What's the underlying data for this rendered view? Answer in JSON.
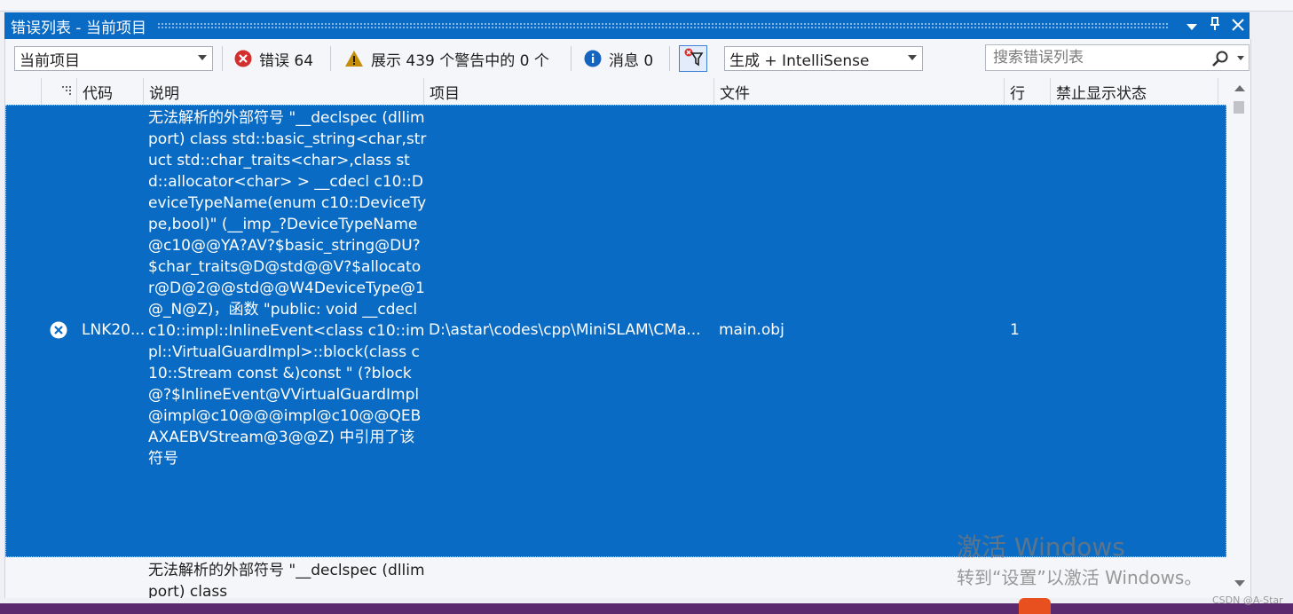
{
  "title_bar": {
    "title": "错误列表 - 当前项目",
    "dropdown_icon": "▼",
    "pin_icon": "📌",
    "close_icon": "✕"
  },
  "toolbar": {
    "scope_value": "当前项目",
    "errors_label": "错误 64",
    "warnings_label": "展示 439 个警告中的 0 个",
    "messages_label": "消息 0",
    "build_filter_value": "生成 + IntelliSense",
    "search_placeholder": "搜索错误列表"
  },
  "columns": [
    "代码",
    "说明",
    "项目",
    "文件",
    "行",
    "禁止显示状态"
  ],
  "rows": [
    {
      "code": "LNK20...",
      "description": "无法解析的外部符号 \"__declspec (dllimport) class std::basic_string<char,struct std::char_traits<char>,class std::allocator<char> > __cdecl c10::DeviceTypeName(enum c10::DeviceType,bool)\" (__imp_?DeviceTypeName@c10@@YA?AV?$basic_string@DU?$char_traits@D@std@@V?$allocator@D@2@@std@@W4DeviceType@1@_N@Z)，函数 \"public: void __cdecl c10::impl::InlineEvent<class c10::impl::VirtualGuardImpl>::block(class c10::Stream const &)const \" (?block@?$InlineEvent@VVirtualGuardImpl@impl@c10@@@impl@c10@@QEBAXAEBVStream@3@@Z) 中引用了该符号",
      "project": "D:\\astar\\codes\\cpp\\MiniSLAM\\CMa...",
      "file": "main.obj",
      "line": "1"
    },
    {
      "description": "无法解析的外部符号 \"__declspec (dllimport) class"
    }
  ],
  "watermark": {
    "line1": "激活 Windows",
    "line2": "转到“设置”以激活 Windows。"
  },
  "credit": "CSDN @A-Star",
  "colors": {
    "accent": "#0a6bc4",
    "error": "#d32f2f",
    "warning": "#c78c06",
    "info": "#1565c0"
  }
}
